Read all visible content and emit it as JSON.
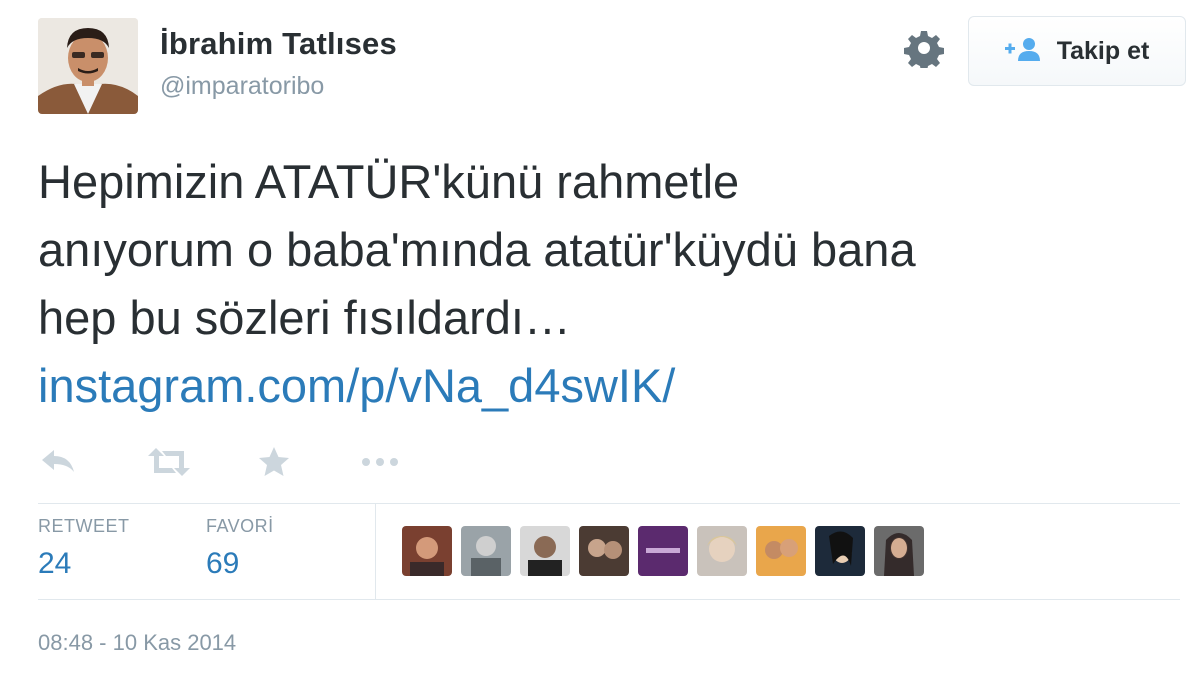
{
  "user": {
    "name": "İbrahim Tatlıses",
    "handle": "@imparatoribo"
  },
  "follow_button": {
    "label": "Takip et",
    "icon": "add-user-icon"
  },
  "settings": {
    "icon": "gear-icon"
  },
  "tweet": {
    "lines": [
      "Hepimizin ATATÜR'künü rahmetle",
      "anıyorum o baba'mında atatür'küydü bana",
      "hep bu sözleri fısıldardı…"
    ],
    "link": "instagram.com/p/vNa_d4swIK/"
  },
  "actions": [
    "reply-icon",
    "retweet-icon",
    "favorite-icon",
    "more-icon"
  ],
  "stats": {
    "retweet_label": "RETWEET",
    "retweet_count": "24",
    "favorite_label": "FAVORİ",
    "favorite_count": "69"
  },
  "favoriters_count_shown": 9,
  "timestamp": "08:48 - 10 Kas 2014",
  "colors": {
    "link": "#2b7bb9",
    "muted": "#8899a6",
    "text": "#292f33",
    "border": "#e1e8ed"
  }
}
